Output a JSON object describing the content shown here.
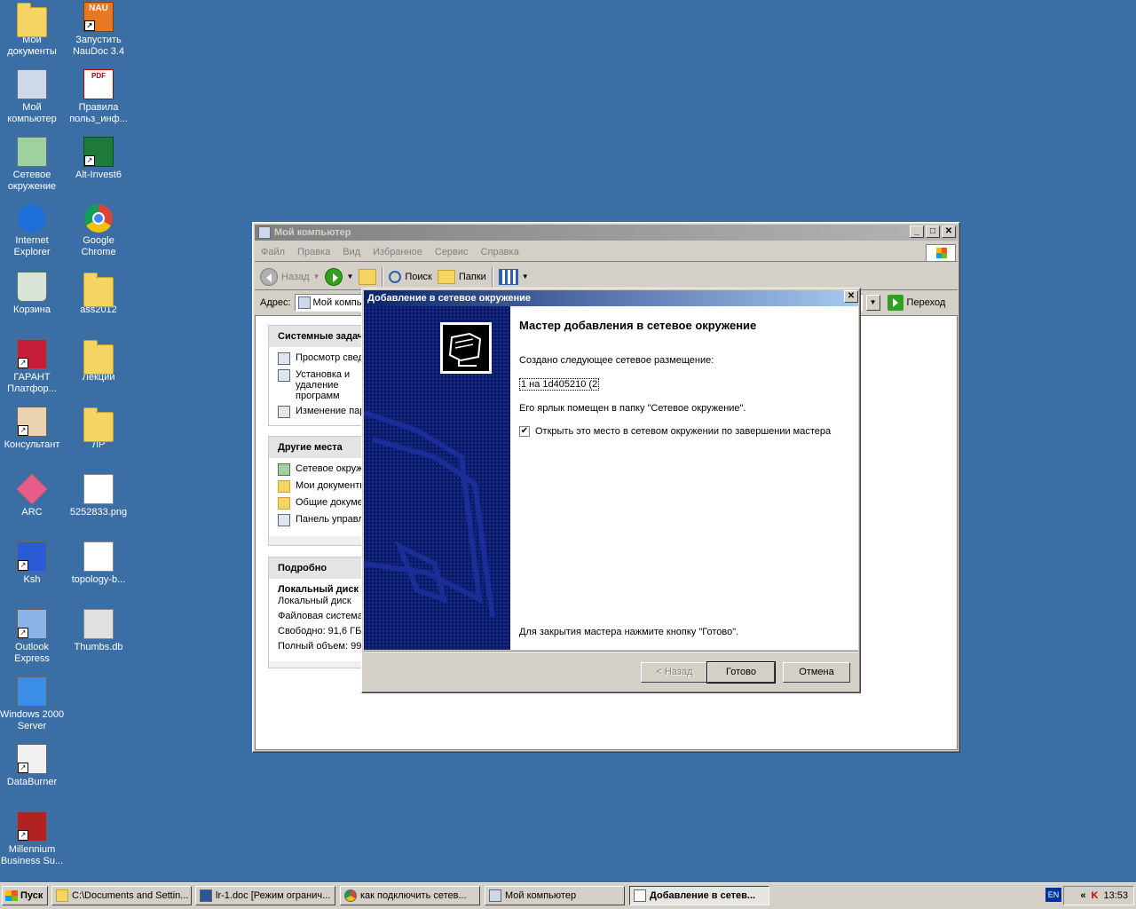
{
  "desktop": {
    "icons": [
      {
        "label": "Мои документы",
        "icon": "my-documents-icon"
      },
      {
        "label": "Запустить NauDoc 3.4",
        "icon": "naudoc-icon",
        "badge": "NAU"
      },
      {
        "label": "Мой компьютер",
        "icon": "my-computer-icon"
      },
      {
        "label": "Правила польз_инф...",
        "icon": "pdf-document-icon",
        "badge": "PDF"
      },
      {
        "label": "Сетевое окружение",
        "icon": "network-places-icon"
      },
      {
        "label": "Alt-Invest6",
        "icon": "excel-icon"
      },
      {
        "label": "Internet Explorer",
        "icon": "internet-explorer-icon"
      },
      {
        "label": "Google Chrome",
        "icon": "chrome-icon"
      },
      {
        "label": "Корзина",
        "icon": "recycle-bin-icon"
      },
      {
        "label": "ass2012",
        "icon": "folder-icon"
      },
      {
        "label": "ГАРАНТ Платфор...",
        "icon": "garant-icon"
      },
      {
        "label": "Лекции",
        "icon": "folder-icon"
      },
      {
        "label": "Консультант",
        "icon": "consultant-icon"
      },
      {
        "label": "ЛР",
        "icon": "folder-icon"
      },
      {
        "label": "ARC",
        "icon": "arc-icon"
      },
      {
        "label": "5252833.png",
        "icon": "image-file-icon"
      },
      {
        "label": "Ksh",
        "icon": "ksh-icon"
      },
      {
        "label": "topology-b...",
        "icon": "image-file-icon"
      },
      {
        "label": "Outlook Express",
        "icon": "outlook-express-icon"
      },
      {
        "label": "Thumbs.db",
        "icon": "thumbs-db-icon"
      },
      {
        "label": "Windows 2000 Server",
        "icon": "windows-2000-icon"
      },
      {
        "label": "DataBurner",
        "icon": "databurner-icon"
      },
      {
        "label": "Millennium Business Su...",
        "icon": "millennium-icon"
      }
    ]
  },
  "explorer": {
    "title": "Мой компьютер",
    "menu": [
      "Файл",
      "Правка",
      "Вид",
      "Избранное",
      "Сервис",
      "Справка"
    ],
    "toolbar": {
      "back": "Назад",
      "search": "Поиск",
      "folders": "Папки"
    },
    "address": {
      "label": "Адрес:",
      "value": "Мой компьютер",
      "go": "Переход"
    },
    "system_tasks": {
      "header": "Системные задачи",
      "items": [
        "Просмотр сведений о системе",
        "Установка и удаление программ",
        "Изменение параметра"
      ]
    },
    "other_places": {
      "header": "Другие места",
      "items": [
        "Сетевое окружение",
        "Мои документы",
        "Общие документы",
        "Панель управления"
      ]
    },
    "details": {
      "header": "Подробно",
      "name": "Локальный диск",
      "type": "Локальный диск",
      "fs": "Файловая система",
      "free": "Свободно: 91,6 ГБ",
      "total": "Полный объем: 99"
    }
  },
  "wizard": {
    "title": "Добавление в сетевое окружение",
    "heading": "Мастер добавления в сетевое окружение",
    "created_text": "Создано следующее сетевое размещение:",
    "location": "1 на 1d405210 (2",
    "shortcut_text": "Его ярлык помещен в папку \"Сетевое окружение\".",
    "checkbox_label": "Открыть это место в сетевом окружении по завершении мастера",
    "checkbox_checked": true,
    "footer_text": "Для закрытия мастера нажмите кнопку \"Готово\".",
    "buttons": {
      "back": "< Назад",
      "finish": "Готово",
      "cancel": "Отмена"
    }
  },
  "taskbar": {
    "start": "Пуск",
    "tasks": [
      {
        "label": "C:\\Documents and Settin...",
        "icon": "folder-icon"
      },
      {
        "label": "lr-1.doc [Режим огранич...",
        "icon": "word-icon"
      },
      {
        "label": "как подключить сетев...",
        "icon": "chrome-icon"
      },
      {
        "label": "Мой компьютер",
        "icon": "my-computer-icon"
      },
      {
        "label": "Добавление в сетев...",
        "icon": "wizard-window-icon"
      }
    ],
    "lang": "EN",
    "clock": "13:53"
  }
}
